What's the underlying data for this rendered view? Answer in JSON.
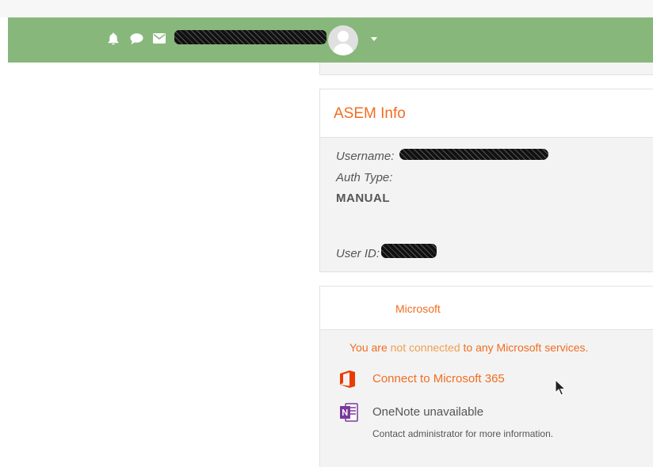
{
  "navbar": {
    "bg": "#88b77b",
    "icons": [
      "bell-icon",
      "chat-icon",
      "envelope-icon"
    ],
    "username": "[redacted]",
    "user_menu_caret": "▾"
  },
  "asem_info": {
    "title": "ASEM Info",
    "username_label": "Username:",
    "username_value": "[redacted]",
    "auth_type_label": "Auth Type:",
    "auth_type_value": "MANUAL",
    "user_id_label": "User ID:",
    "user_id_value": "[redacted]"
  },
  "microsoft": {
    "title": "Microsoft",
    "status_prefix": "You are",
    "status_mid": "not connected",
    "status_suffix": "to any Microsoft services.",
    "connect_link": "Connect to Microsoft 365",
    "onenote_label": "OneNote unavailable",
    "onenote_note": "Contact administrator for more information."
  },
  "colors": {
    "accent": "#f26d21",
    "muted_accent": "#f0a050",
    "text": "#555555"
  }
}
